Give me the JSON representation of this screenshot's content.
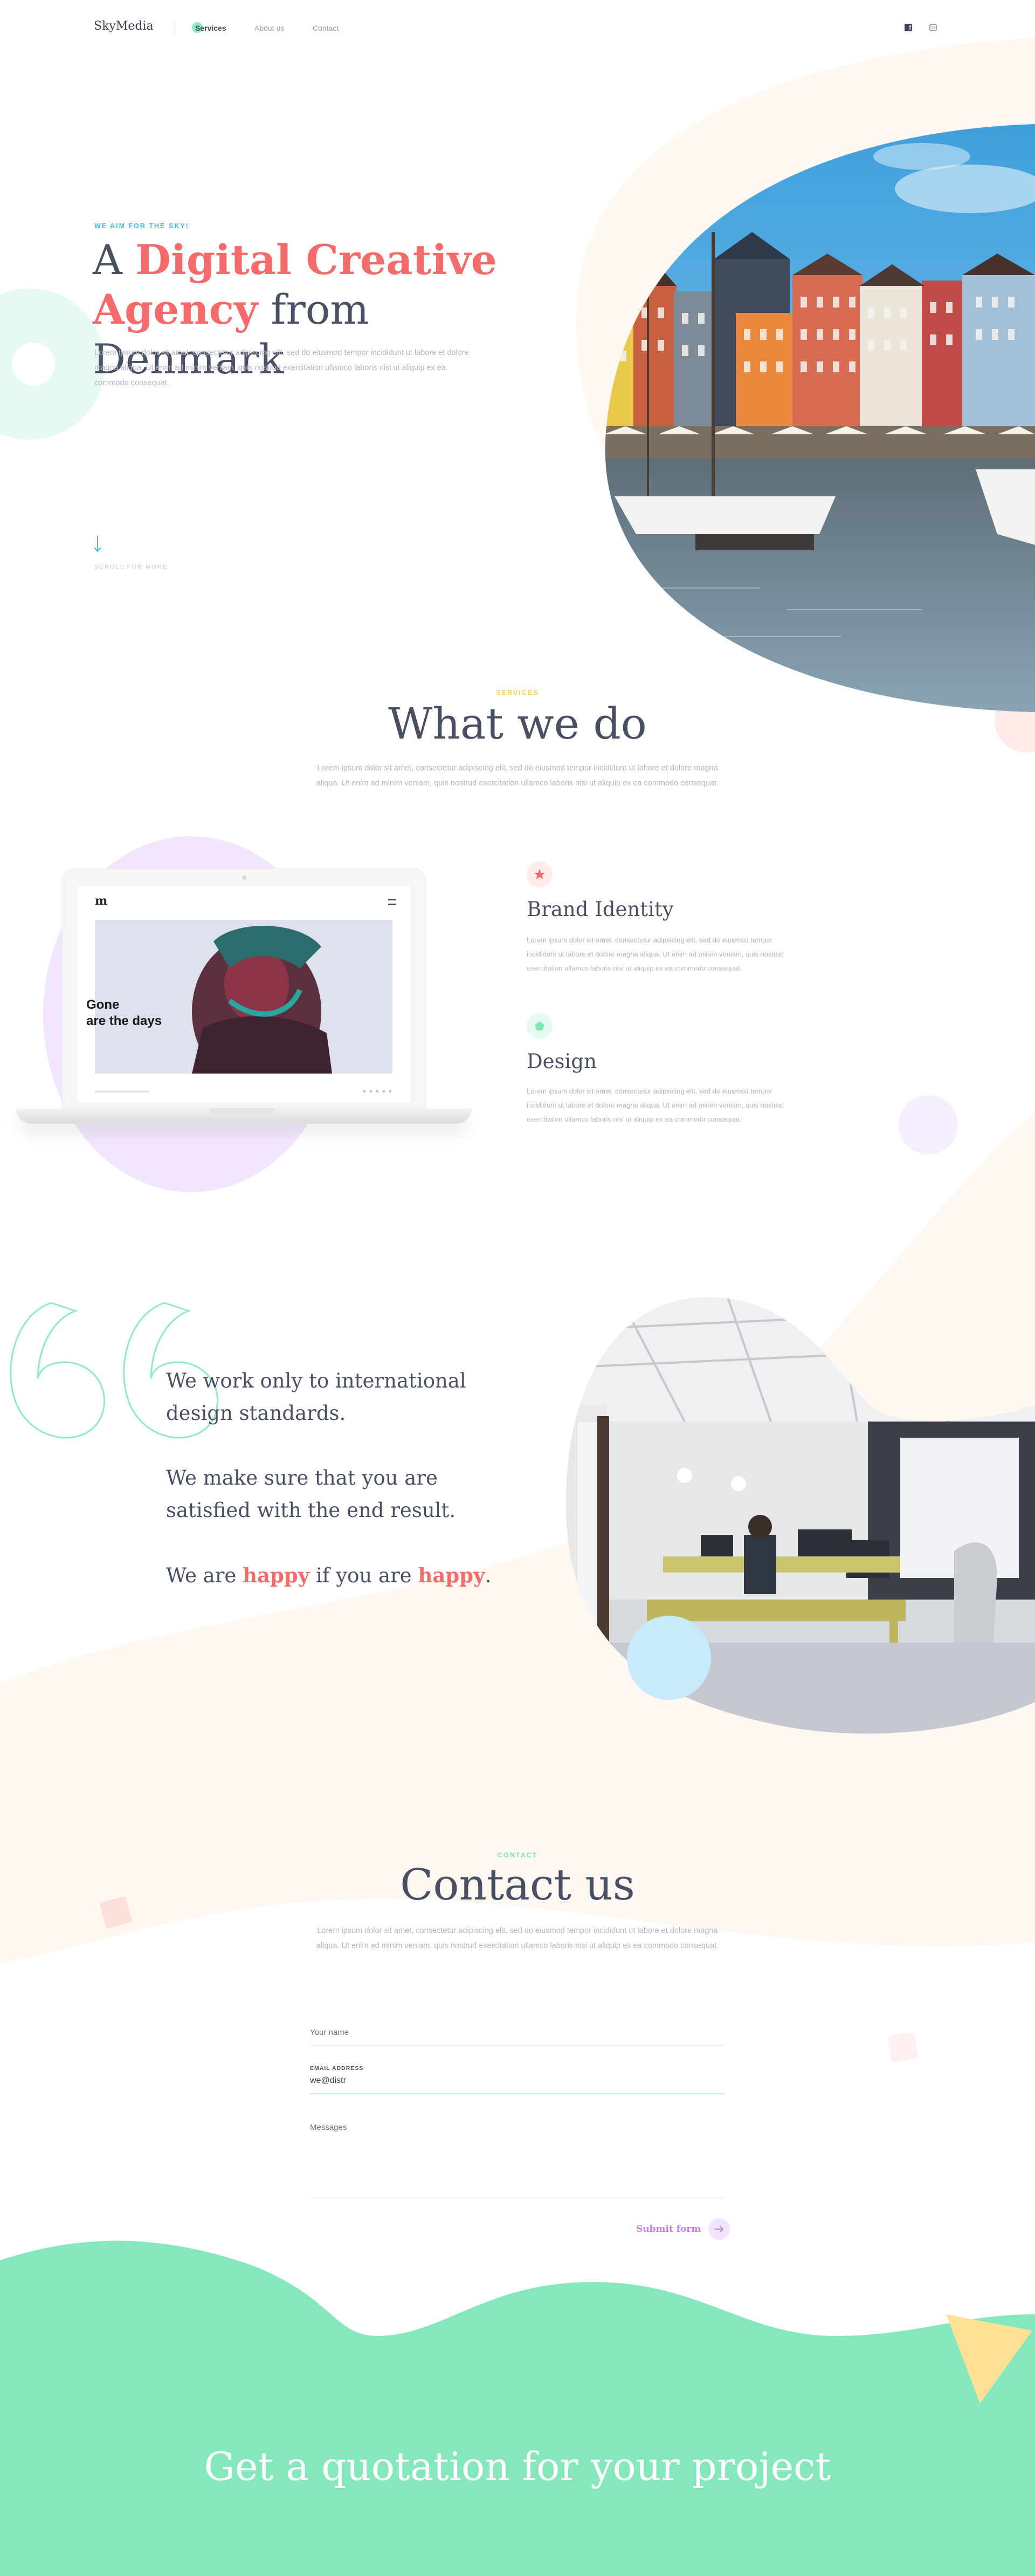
{
  "colors": {
    "accent_red": "#f56b6b",
    "accent_teal": "#7fe6b8",
    "accent_blue": "#40bde0",
    "accent_yellow": "#ffcf55",
    "accent_purple": "#c77df0",
    "text_dark": "#4a5063",
    "text_muted": "#b8b6c6"
  },
  "header": {
    "logo": "SkyMedia",
    "nav": [
      "Services",
      "About us",
      "Contact"
    ],
    "social_icons": [
      "facebook-icon",
      "instagram-icon"
    ]
  },
  "hero": {
    "eyebrow": "WE AIM FOR THE SKY!",
    "title_a": "A ",
    "title_highlight1": "Digital Creative",
    "title_highlight2": "Agency",
    "title_rest": " from Denmark",
    "body": "Lorem ipsum dolor sit amet, consectetur adipiscing elit, sed do eiusmod tempor incididunt ut labore et dolore magna aliqua. Ut enim ad minim veniam, quis nostrud exercitation ullamco laboris nisi ut aliquip ex ea commodo consequat.",
    "scroll_label": "SCROLL FOR MORE",
    "image_alt": "Colorful harbour houses with boats"
  },
  "services": {
    "eyebrow": "SERVICES",
    "title": "What we do",
    "body": "Lorem ipsum dolor sit amet, consectetur adipiscing elit, sed do eiusmod tempor incididunt ut labore et dolore magna aliqua. Ut enim ad minim veniam, quis nostrud exercitation ullamco laboris nisi ut aliquip ex ea commodo consequat.",
    "laptop": {
      "logo": "m",
      "headline_line1": "Gone",
      "headline_line2": "are the days"
    },
    "items": [
      {
        "icon": "star-icon",
        "title": "Brand Identity",
        "body": "Lorem ipsum dolor sit amet, consectetur adipiscing elit, sed do eiusmod tempor incididunt ut labore et dolore magna aliqua. Ut enim ad minim veniam, quis nostrud exercitation ullamco laboris nisi ut aliquip ex ea commodo consequat."
      },
      {
        "icon": "pentagon-icon",
        "title": "Design",
        "body": "Lorem ipsum dolor sit amet, consectetur adipiscing elit, sed do eiusmod tempor incididunt ut labore et dolore magna aliqua. Ut enim ad minim veniam, quis nostrud exercitation ullamco laboris nisi ut aliquip ex ea commodo consequat."
      }
    ]
  },
  "quote": {
    "line1a": "We work only to international",
    "line1b": "design standards.",
    "line2a": "We make sure that you are",
    "line2b": "satisfied with the end result.",
    "line3_a": "We are ",
    "line3_h1": "happy",
    "line3_b": " if you are ",
    "line3_h2": "happy",
    "line3_c": ".",
    "image_alt": "Open plan office with desks and monitors"
  },
  "contact": {
    "eyebrow": "CONTACT",
    "title": "Contact us",
    "body": "Lorem ipsum dolor sit amet, consectetur adipiscing elit, sed do eiusmod tempor incididunt ut labore et dolore magna aliqua. Ut enim ad minim veniam, quis nostrud exercitation ullamco laboris nisi ut aliquip ex ea commodo consequat.",
    "name_placeholder": "Your name",
    "email_label": "EMAIL ADDRESS",
    "email_value": "we@distr",
    "message_placeholder": "Messages",
    "submit_label": "Submit form"
  },
  "footer": {
    "cta": "Get a quotation for your project"
  }
}
